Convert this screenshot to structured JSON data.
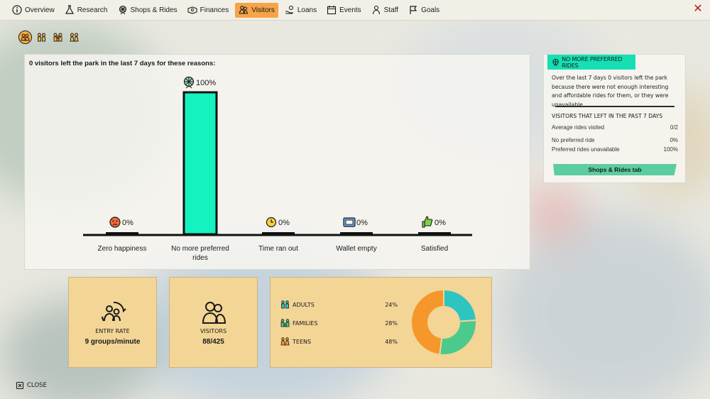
{
  "nav": {
    "tabs": [
      {
        "label": "Overview",
        "icon": "info-icon",
        "active": false
      },
      {
        "label": "Research",
        "icon": "flask-icon",
        "active": false
      },
      {
        "label": "Shops & Rides",
        "icon": "ferris-wheel-icon",
        "active": false
      },
      {
        "label": "Finances",
        "icon": "money-icon",
        "active": false
      },
      {
        "label": "Visitors",
        "icon": "visitors-icon",
        "active": true
      },
      {
        "label": "Loans",
        "icon": "hand-coin-icon",
        "active": false
      },
      {
        "label": "Events",
        "icon": "calendar-icon",
        "active": false
      },
      {
        "label": "Staff",
        "icon": "staff-icon",
        "active": false
      },
      {
        "label": "Goals",
        "icon": "flag-icon",
        "active": false
      }
    ],
    "close_glyph": "✕"
  },
  "filters": [
    "all-visitors-icon",
    "adults-icon",
    "families-icon",
    "teens-icon"
  ],
  "chart_data": {
    "type": "bar",
    "title": "0 visitors left the park in the last 7 days for these reasons:",
    "categories": [
      "Zero happiness",
      "No more preferred rides",
      "Time ran out",
      "Wallet empty",
      "Satisfied"
    ],
    "values": [
      0,
      100,
      0,
      0,
      0
    ],
    "value_labels": [
      "0%",
      "100%",
      "0%",
      "0%",
      "0%"
    ],
    "icons": [
      "sad-face-icon",
      "ferris-wheel-icon",
      "clock-icon",
      "wallet-icon",
      "thumbs-up-icon"
    ],
    "ylim": [
      0,
      100
    ],
    "highlight_color": "#14f2c0",
    "grid": false
  },
  "info": {
    "header": "NO MORE PREFERRED RIDES",
    "description": "Over the last 7 days 0 visitors left the park because there were not enough interesting and affordable rides for them, or they were unavailable.",
    "subheading": "VISITORS THAT LEFT IN THE PAST 7 DAYS",
    "stats": [
      {
        "label": "Average rides visited",
        "value": "0/2"
      },
      {
        "label": "No preferred ride",
        "value": "0%"
      },
      {
        "label": "Preferred rides unavailable",
        "value": "100%"
      }
    ],
    "button": "Shops & Rides tab"
  },
  "entry": {
    "label": "ENTRY RATE",
    "value": "9 groups/minute"
  },
  "visitors": {
    "label": "VISITORS",
    "value": "88/425"
  },
  "segments": [
    {
      "label": "ADULTS",
      "value": "24%",
      "pct": 24,
      "color": "#2ec4c0"
    },
    {
      "label": "FAMILIES",
      "value": "28%",
      "pct": 28,
      "color": "#4cc98c"
    },
    {
      "label": "TEENS",
      "value": "48%",
      "pct": 48,
      "color": "#f5972a"
    }
  ],
  "close_label": "CLOSE"
}
